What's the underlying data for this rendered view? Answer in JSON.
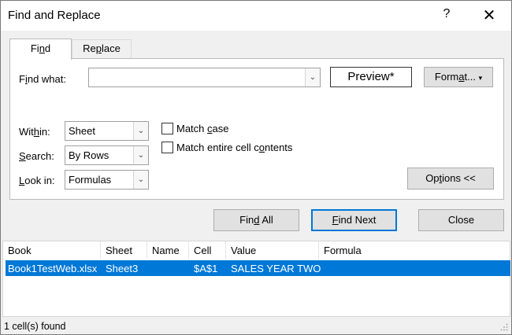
{
  "window": {
    "title": "Find and Replace",
    "help_glyph": "?",
    "close_glyph": "✕"
  },
  "tabs": [
    {
      "label_pre": "Fi",
      "label_u": "n",
      "label_post": "d",
      "active": true
    },
    {
      "label_pre": "Re",
      "label_u": "p",
      "label_post": "lace",
      "active": false
    }
  ],
  "find": {
    "label_pre": "F",
    "label_u": "i",
    "label_post": "nd what:",
    "value": "",
    "preview": "Preview*",
    "format_pre": "Form",
    "format_u": "a",
    "format_post": "t...",
    "format_arrow": "▾"
  },
  "options": {
    "within": {
      "label_pre": "Wit",
      "label_u": "h",
      "label_post": "in:",
      "value": "Sheet"
    },
    "search": {
      "label_pre": "",
      "label_u": "S",
      "label_post": "earch:",
      "value": "By Rows"
    },
    "look_in": {
      "label_pre": "",
      "label_u": "L",
      "label_post": "ook in:",
      "value": "Formulas"
    },
    "match_case": {
      "label_pre": "Match ",
      "label_u": "c",
      "label_post": "ase",
      "checked": false
    },
    "match_entire": {
      "label_pre": "Match entire cell c",
      "label_u": "o",
      "label_post": "ntents",
      "checked": false
    },
    "options_button": {
      "label_pre": "Op",
      "label_u": "t",
      "label_post": "ions <<"
    }
  },
  "actions": {
    "find_all": {
      "label_pre": "Fin",
      "label_u": "d",
      "label_post": " All"
    },
    "find_next": {
      "label_pre": "",
      "label_u": "F",
      "label_post": "ind Next"
    },
    "close": "Close"
  },
  "results": {
    "columns": [
      "Book",
      "Sheet",
      "Name",
      "Cell",
      "Value",
      "Formula"
    ],
    "rows": [
      {
        "book": "Book1TestWeb.xlsx",
        "sheet": "Sheet3",
        "name": "",
        "cell": "$A$1",
        "value": "SALES YEAR TWO",
        "formula": ""
      }
    ],
    "selection_color": "#0078d7"
  },
  "status": "1 cell(s) found"
}
